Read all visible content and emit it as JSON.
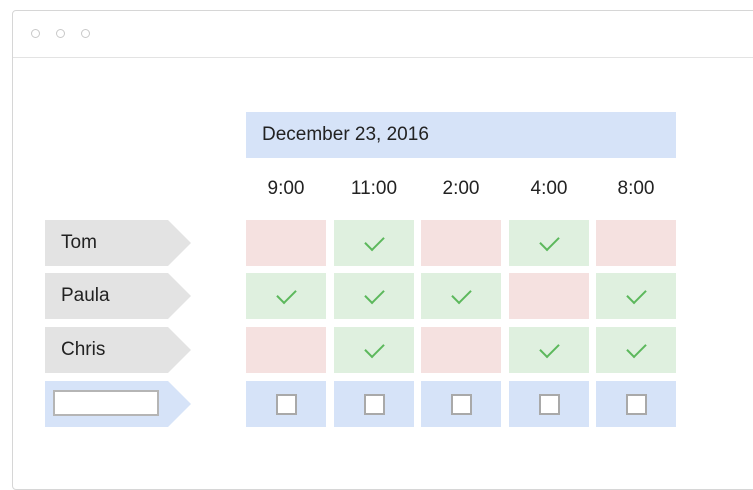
{
  "poll": {
    "date": "December 23, 2016",
    "times": [
      "9:00",
      "11:00",
      "2:00",
      "4:00",
      "8:00"
    ],
    "participants": [
      {
        "name": "Tom",
        "availability": [
          false,
          true,
          false,
          true,
          false
        ]
      },
      {
        "name": "Paula",
        "availability": [
          true,
          true,
          true,
          false,
          true
        ]
      },
      {
        "name": "Chris",
        "availability": [
          false,
          true,
          false,
          true,
          true
        ]
      }
    ],
    "new_entry": {
      "name_value": "",
      "slots_checked": [
        false,
        false,
        false,
        false,
        false
      ]
    }
  },
  "icons": {
    "window_controls": [
      "window-dot-icon",
      "window-dot-icon",
      "window-dot-icon"
    ],
    "available": "checkmark-icon",
    "slot_choice": "checkbox-icon"
  },
  "colors": {
    "header_bg": "#d6e3f8",
    "available_bg": "#dff0df",
    "unavailable_bg": "#f5e1e0",
    "check": "#5cb85c",
    "name_tag_bg": "#e3e3e3"
  }
}
